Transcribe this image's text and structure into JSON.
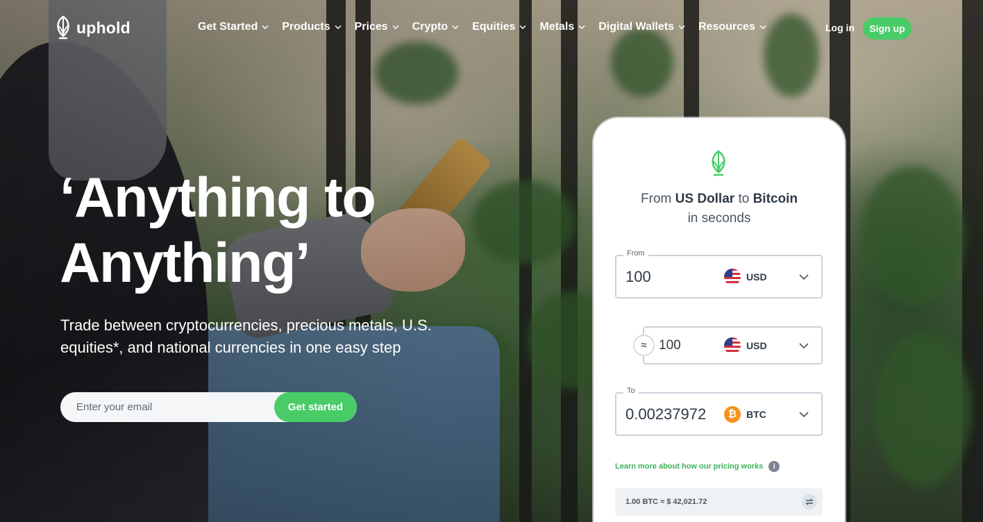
{
  "brand": {
    "name": "uphold",
    "accent": "#49cc68"
  },
  "nav": {
    "items": [
      {
        "label": "Get Started"
      },
      {
        "label": "Products"
      },
      {
        "label": "Prices"
      },
      {
        "label": "Crypto"
      },
      {
        "label": "Equities"
      },
      {
        "label": "Metals"
      },
      {
        "label": "Digital Wallets"
      },
      {
        "label": "Resources"
      }
    ],
    "login": "Log in",
    "signup": "Sign up"
  },
  "hero": {
    "headline_line1": "‘Anything to",
    "headline_line2": "Anything’",
    "subtext": "Trade between cryptocurrencies, precious metals, U.S. equities*, and national currencies in one easy step",
    "email_placeholder": "Enter your email",
    "cta": "Get started"
  },
  "widget": {
    "title_prefix": "From ",
    "title_from": "US Dollar",
    "title_mid": " to ",
    "title_to": "Bitcoin",
    "title_suffix": "in seconds",
    "from": {
      "label": "From",
      "value": "100",
      "currency": "USD",
      "icon": "us-flag-icon"
    },
    "middle": {
      "value": "100",
      "currency": "USD",
      "icon": "us-flag-icon",
      "approx_symbol": "≈"
    },
    "to": {
      "label": "To",
      "value": "0.00237972",
      "currency": "BTC",
      "icon": "bitcoin-icon",
      "icon_glyph": "₿"
    },
    "learn_more": "Learn more about how our pricing works",
    "info_glyph": "i",
    "rate": "1.00 BTC ≈ $ 42,021.72"
  }
}
